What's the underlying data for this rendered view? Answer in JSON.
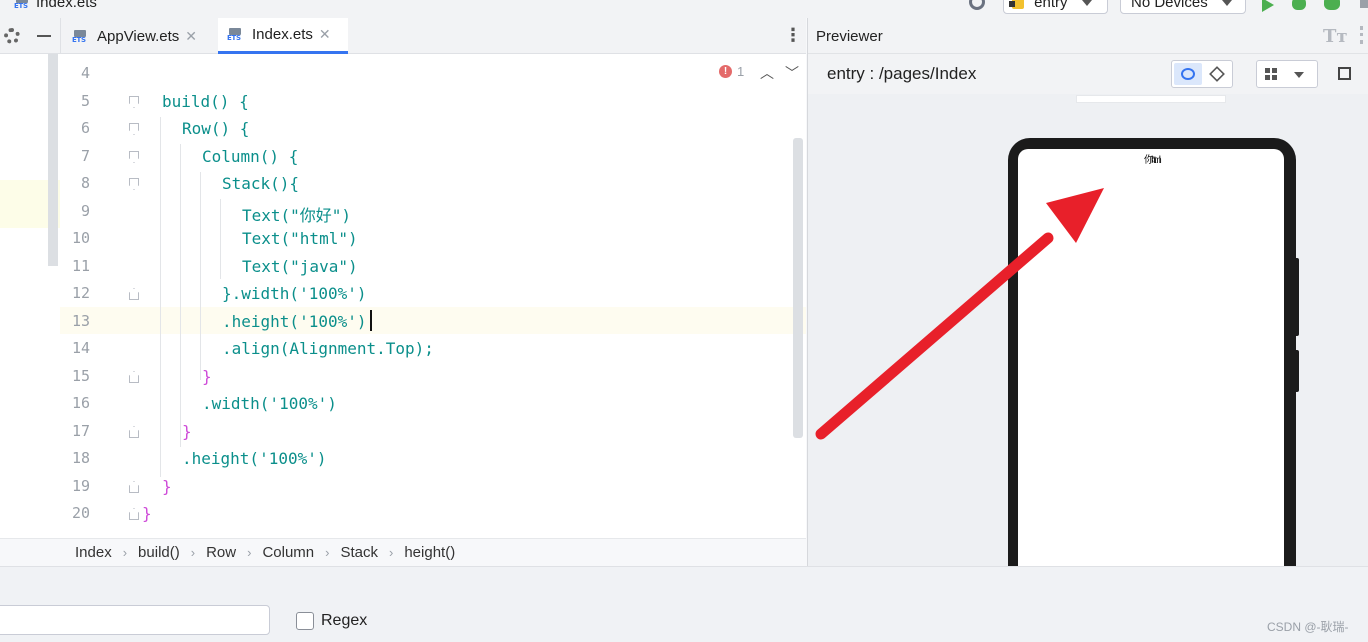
{
  "window": {
    "file_title": "Index.ets",
    "run_config": "entry",
    "device": "No Devices"
  },
  "tabs": [
    {
      "label": "AppView.ets",
      "active": false
    },
    {
      "label": "Index.ets",
      "active": true
    }
  ],
  "editor": {
    "problems_count": "1",
    "lines": [
      {
        "num": "4",
        "text": ""
      },
      {
        "num": "5",
        "text": "build() {"
      },
      {
        "num": "6",
        "text": "Row() {"
      },
      {
        "num": "7",
        "text": "Column() {"
      },
      {
        "num": "8",
        "text": "Stack(){"
      },
      {
        "num": "9",
        "text": "Text(\"你好\")"
      },
      {
        "num": "10",
        "text": "Text(\"html\")"
      },
      {
        "num": "11",
        "text": "Text(\"java\")"
      },
      {
        "num": "12",
        "text": "}.width('100%')"
      },
      {
        "num": "13",
        "text": ".height('100%')"
      },
      {
        "num": "14",
        "text": ".align(Alignment.Top);"
      },
      {
        "num": "15",
        "text": "}"
      },
      {
        "num": "16",
        "text": ".width('100%')"
      },
      {
        "num": "17",
        "text": "}"
      },
      {
        "num": "18",
        "text": ".height('100%')"
      },
      {
        "num": "19",
        "text": "}"
      },
      {
        "num": "20",
        "text": "}"
      }
    ]
  },
  "breadcrumb": [
    "Index",
    "build()",
    "Row",
    "Column",
    "Stack",
    "height()"
  ],
  "previewer": {
    "title": "Previewer",
    "path": "entry : /pages/Index",
    "device_text": "你html"
  },
  "search": {
    "regex_label": "Regex",
    "regex_checked": false
  },
  "watermark": "CSDN @-耿瑞-",
  "colors": {
    "arrow": "#e8202a",
    "accent": "#3574f0",
    "run": "#4caf50"
  }
}
